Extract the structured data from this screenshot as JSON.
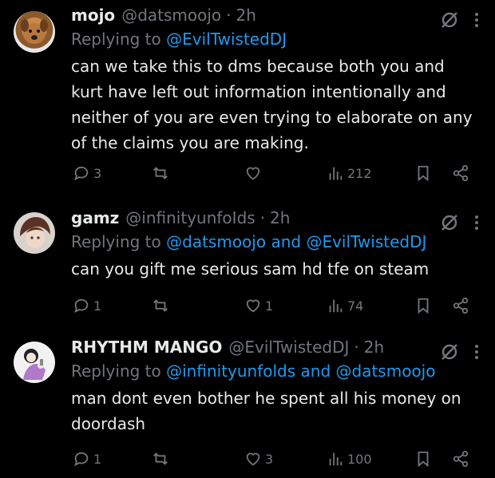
{
  "tweets": [
    {
      "name": "mojo",
      "handle": "@datsmoojo",
      "separator": "·",
      "time": "2h",
      "replying_prefix": "Replying to ",
      "replying_targets": [
        "@EvilTwistedDJ"
      ],
      "text": "can we take this to dms because both you and kurt have left out information intentionally and neither of you are even trying to elaborate on any of the claims you are making.",
      "replies": "3",
      "reposts": "",
      "likes": "",
      "views": "212"
    },
    {
      "name": "gamz",
      "handle": "@infinityunfoIds",
      "separator": "·",
      "time": "2h",
      "replying_prefix": "Replying to ",
      "replying_targets": [
        "@datsmoojo",
        "@EvilTwistedDJ"
      ],
      "replying_joiner": " and ",
      "text": "can you gift me serious sam hd tfe on steam",
      "replies": "1",
      "reposts": "",
      "likes": "1",
      "views": "74"
    },
    {
      "name": "RHYTHM MANGO",
      "handle": "@EvilTwistedDJ",
      "separator": "·",
      "time": "2h",
      "replying_prefix": "Replying to ",
      "replying_targets": [
        "@infinityunfolds",
        "@datsmoojo"
      ],
      "replying_joiner": " and ",
      "text": "man dont even bother he spent all his money on doordash",
      "replies": "1",
      "reposts": "",
      "likes": "3",
      "views": "100"
    }
  ],
  "colors": {
    "background": "#000000",
    "text": "#e7e9ea",
    "muted": "#71767b",
    "link": "#1d9bf0"
  }
}
